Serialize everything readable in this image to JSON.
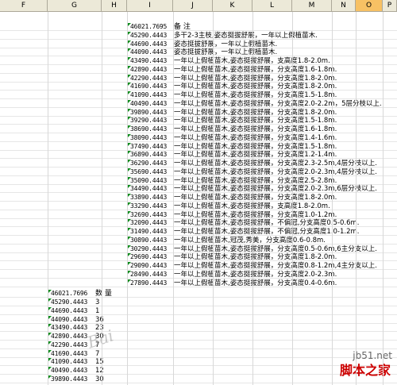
{
  "columns": [
    "F",
    "G",
    "H",
    "I",
    "J",
    "K",
    "L",
    "M",
    "N",
    "O",
    "P"
  ],
  "selected_column": "O",
  "upper_rows": [
    [
      "46021.7695",
      "备  注"
    ],
    [
      "45290.4443",
      "多干2-3主枝,姿态挺拔舒展，一年以上假植苗木."
    ],
    [
      "44690.4443",
      "姿态挺拔舒展，一年以上假植苗木."
    ],
    [
      "44090.4443",
      "姿态挺拔舒展，一年以上假植苗木."
    ],
    [
      "43490.4443",
      "一年以上假植苗木,姿态挺拔舒展，支高度1.8-2.0m."
    ],
    [
      "42890.4443",
      "一年以上假植苗木,姿态挺拔舒展，分支高度1.6-1.8m."
    ],
    [
      "42290.4443",
      "一年以上假植苗木,姿态挺拔舒展，分支高度1.8-2.0m."
    ],
    [
      "41690.4443",
      "一年以上假植苗木,姿态挺拔舒展，分支高度1.8-2.0m."
    ],
    [
      "41090.4443",
      "一年以上假植苗木,姿态挺拔舒展，分支高度1.5-1.8m."
    ],
    [
      "40490.4443",
      "一年以上假植苗木,姿态挺拔舒展，分支高度2.0-2.2m，5层分枝以上."
    ],
    [
      "39890.4443",
      "一年以上假植苗木,姿态挺拔舒展，分支高度1.8-2.0m."
    ],
    [
      "39290.4443",
      "一年以上假植苗木,姿态挺拔舒展，分支高度1.5-1.8m."
    ],
    [
      "38690.4443",
      "一年以上假植苗木,姿态挺拔舒展，分支高度1.6-1.8m."
    ],
    [
      "38090.4443",
      "一年以上假植苗木,姿态挺拔舒展，分支高度1.4-1.6m."
    ],
    [
      "37490.4443",
      "一年以上假植苗木,姿态挺拔舒展，分支高度1.5-1.8m."
    ],
    [
      "36890.4443",
      "一年以上假植苗木,姿态挺拔舒展，分支高度1.2-1.4m."
    ],
    [
      "36290.4443",
      "一年以上假植苗木,姿态挺拔舒展，分支高度2.3-2.5m,4层分枝以上."
    ],
    [
      "35690.4443",
      "一年以上假植苗木,姿态挺拔舒展，分支高度2.0-2.3m,4层分枝以上."
    ],
    [
      "35090.4443",
      "一年以上假植苗木,姿态挺拔舒展，分支高度2.5-2.8m."
    ],
    [
      "34490.4443",
      "一年以上假植苗木,姿态挺拔舒展，分支高度2.0-2.3m,6层分枝以上."
    ],
    [
      "33890.4443",
      "一年以上假植苗木,姿态挺拔舒展，分支高度1.8-2.0m."
    ],
    [
      "33290.4443",
      "一年以上假植苗木,姿态挺拔舒展，支高度1.8-2.0m."
    ],
    [
      "32690.4443",
      "一年以上假植苗木,姿态挺拔舒展，分支高度1.0-1.2m."
    ],
    [
      "32090.4443",
      "一年以上假植苗木,姿态挺拔舒展，不偏冠,分支高度0.5-0.6m."
    ],
    [
      "31490.4443",
      "一年以上假植苗木,姿态挺拔舒展，不偏冠,分支高度1.0-1.2m."
    ],
    [
      "30890.4443",
      "一年以上假植苗木,冠茂,秀美，分支高度0.6-0.8m."
    ],
    [
      "30290.4443",
      "一年以上假植苗木,姿态挺拔舒展，分支高度0.5-0.6m,6主分支以上."
    ],
    [
      "29690.4443",
      "一年以上假植苗木,姿态挺拔舒展，分支高度1.8-2.0m."
    ],
    [
      "29090.4443",
      "一年以上假植苗木,姿态挺拔舒展，分支高度0.8-1.2m,4主分支以上."
    ],
    [
      "28490.4443",
      "一年以上假植苗木,姿态挺拔舒展，分支高度2.0-2.3m."
    ],
    [
      "27890.4443",
      "一年以上假植苗木,姿态挺拔舒展，分支高度0.4-0.6m."
    ]
  ],
  "lower_rows": [
    [
      "46021.7696",
      "数  量"
    ],
    [
      "45290.4443",
      "3"
    ],
    [
      "44690.4443",
      "1"
    ],
    [
      "44090.4443",
      "36"
    ],
    [
      "43490.4443",
      "23"
    ],
    [
      "42890.4443",
      "30"
    ],
    [
      "42290.4443",
      "7"
    ],
    [
      "41690.4443",
      "7"
    ],
    [
      "41090.4443",
      "15"
    ],
    [
      "40490.4443",
      "12"
    ],
    [
      "39890.4443",
      "30"
    ]
  ],
  "watermark": {
    "baidu": "Bai",
    "site": "jb51.net",
    "brand": "脚本之家"
  }
}
